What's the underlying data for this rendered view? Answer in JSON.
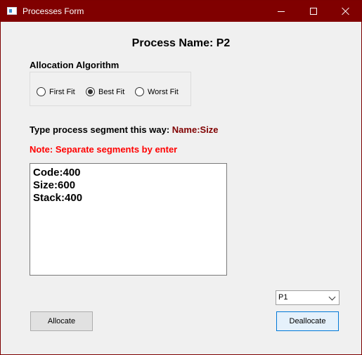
{
  "window": {
    "title": "Processes Form",
    "icon": "app-window-icon",
    "controls": {
      "minimize": "minimize-icon",
      "maximize": "maximize-icon",
      "close": "close-icon"
    },
    "colors": {
      "titlebar": "#800000",
      "note": "#ff0000",
      "format_hint": "#800000"
    }
  },
  "header": {
    "process_title": "Process Name: P2"
  },
  "allocation": {
    "label": "Allocation Algorithm",
    "options": [
      {
        "label": "First Fit",
        "checked": false
      },
      {
        "label": "Best Fit",
        "checked": true
      },
      {
        "label": "Worst Fit",
        "checked": false
      }
    ]
  },
  "instructions": {
    "text": "Type process segment this way: ",
    "format": "Name:Size",
    "note": "Note: Separate segments by enter"
  },
  "segments": {
    "lines": [
      "Code:400",
      "Size:600",
      "Stack:400"
    ]
  },
  "process_select": {
    "selected": "P1"
  },
  "buttons": {
    "allocate": "Allocate",
    "deallocate": "Deallocate"
  }
}
